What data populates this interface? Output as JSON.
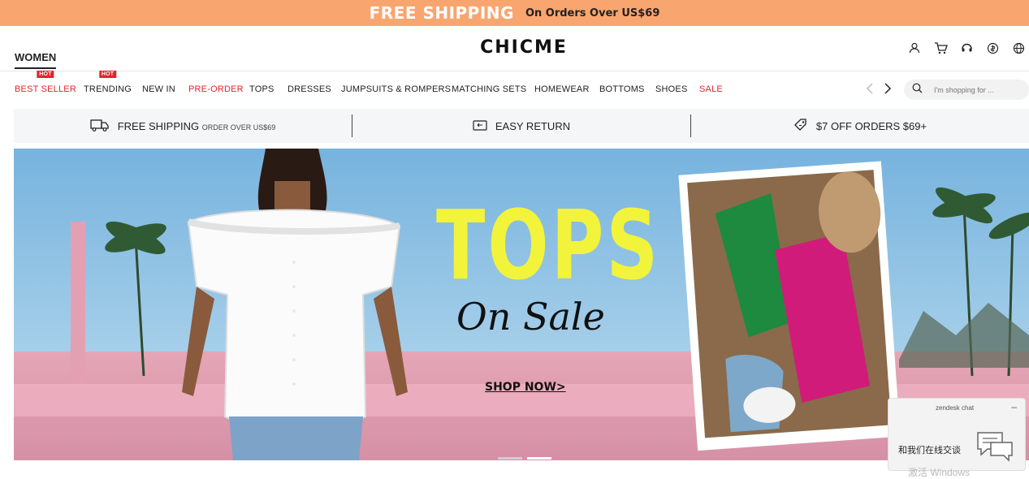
{
  "promo": {
    "big": "FREE SHIPPING",
    "small": "On Orders Over US$69"
  },
  "header": {
    "tab": "WOMEN",
    "logo": "CHICME"
  },
  "nav": {
    "hot_label": "HOT",
    "items": [
      {
        "label": "BEST SELLER"
      },
      {
        "label": "TRENDING"
      },
      {
        "label": "NEW IN"
      },
      {
        "label": "PRE-ORDER"
      },
      {
        "label": "TOPS"
      },
      {
        "label": "DRESSES"
      },
      {
        "label": "JUMPSUITS & ROMPERS"
      },
      {
        "label": "MATCHING SETS"
      },
      {
        "label": "HOMEWEAR"
      },
      {
        "label": "BOTTOMS"
      },
      {
        "label": "SHOES"
      },
      {
        "label": "SALE"
      }
    ],
    "search_placeholder": "I'm shopping for ..."
  },
  "benefits": {
    "shipping": "FREE SHIPPING",
    "shipping_small": "ORDER OVER US$69",
    "returns": "EASY RETURN",
    "discount": "$7 OFF ORDERS $69+"
  },
  "hero": {
    "title": "TOPS",
    "subtitle": "On Sale",
    "cta": "SHOP NOW>"
  },
  "chat": {
    "title": "zendesk chat",
    "minimize": "–",
    "message": "和我们在线交谈",
    "watermark": "激活 Windows"
  },
  "colors": {
    "promo_bg": "#f9a56f",
    "accent_red": "#e0242d",
    "hero_title": "#f1f43a"
  }
}
